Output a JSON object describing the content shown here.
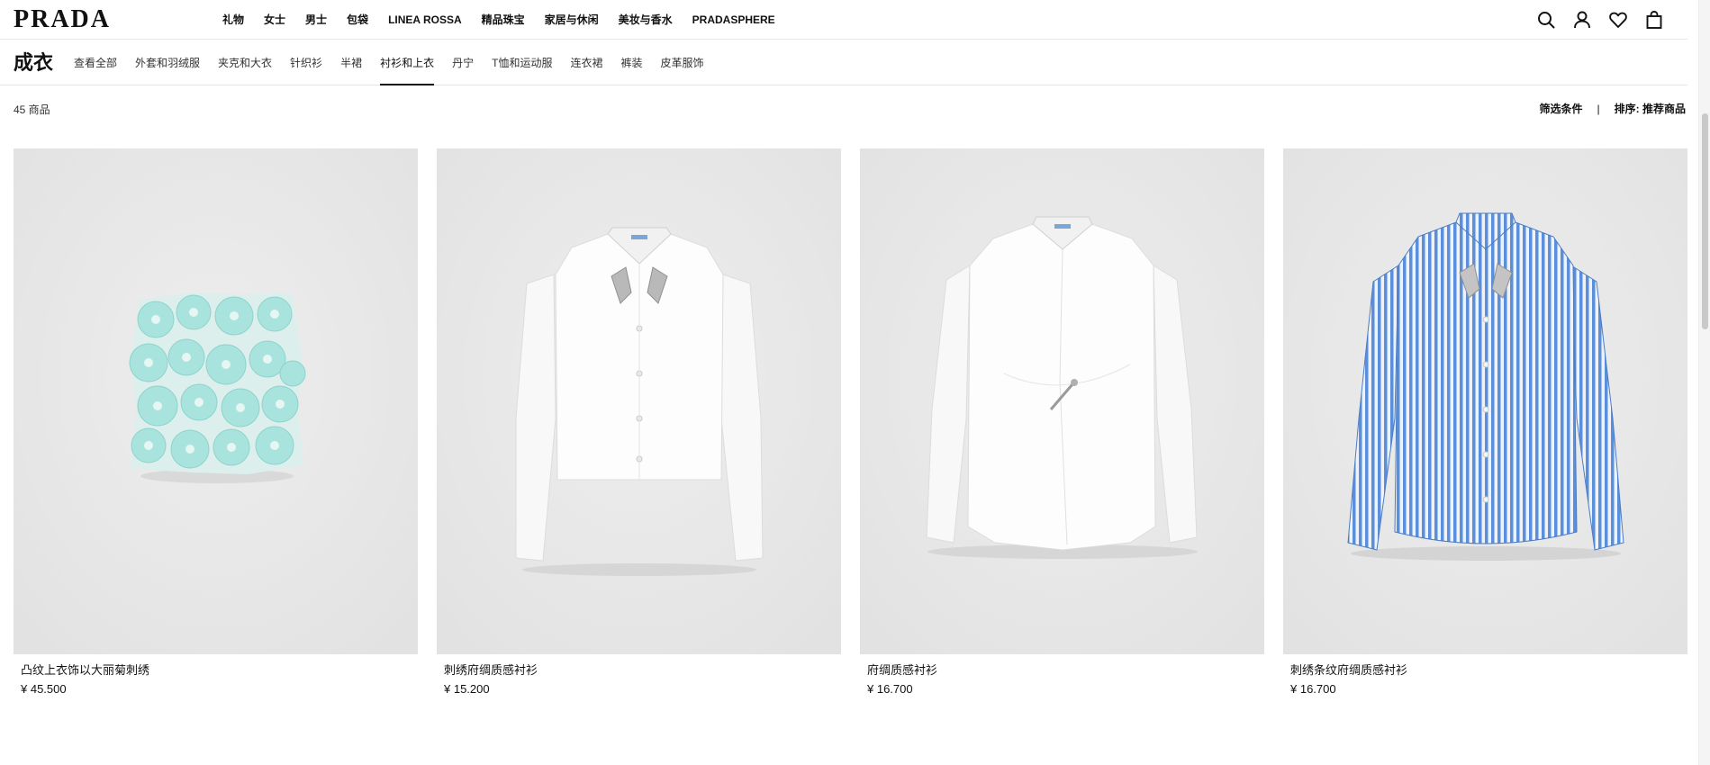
{
  "brand": {
    "logo": "PRADA"
  },
  "main_nav": [
    {
      "label": "礼物"
    },
    {
      "label": "女士"
    },
    {
      "label": "男士"
    },
    {
      "label": "包袋"
    },
    {
      "label": "LINEA ROSSA"
    },
    {
      "label": "精品珠宝"
    },
    {
      "label": "家居与休闲"
    },
    {
      "label": "美妆与香水"
    },
    {
      "label": "PRADASPHERE"
    }
  ],
  "header_icons": [
    "search-icon",
    "account-icon",
    "wishlist-heart-icon",
    "shopping-bag-icon"
  ],
  "category": {
    "title": "成衣",
    "subnav": [
      {
        "label": "查看全部"
      },
      {
        "label": "外套和羽绒服"
      },
      {
        "label": "夹克和大衣"
      },
      {
        "label": "针织衫"
      },
      {
        "label": "半裙"
      },
      {
        "label": "衬衫和上衣",
        "active": true
      },
      {
        "label": "丹宁"
      },
      {
        "label": "T恤和运动服"
      },
      {
        "label": "连衣裙"
      },
      {
        "label": "裤装"
      },
      {
        "label": "皮革服饰"
      }
    ]
  },
  "results": {
    "count_text": "45 商品",
    "filter_label": "筛选条件",
    "separator": "|",
    "sort_label": "排序: 推荐商品"
  },
  "products": [
    {
      "name": "凸纹上衣饰以大丽菊刺绣",
      "price": "¥ 45.500",
      "image": "mint-floral-embroidered-top"
    },
    {
      "name": "刺绣府绸质感衬衫",
      "price": "¥ 15.200",
      "image": "white-cropped-shirt-crystal-collar"
    },
    {
      "name": "府绸质感衬衫",
      "price": "¥ 16.700",
      "image": "white-draped-shirt-brooch"
    },
    {
      "name": "刺绣条纹府绸质感衬衫",
      "price": "¥ 16.700",
      "image": "blue-striped-shirt-crystal-collar"
    }
  ],
  "colors": {
    "text": "#111111",
    "image_bg": "#e8e8e8",
    "stripe_blue": "#5b8fd9",
    "mint": "#a9e3dd"
  }
}
